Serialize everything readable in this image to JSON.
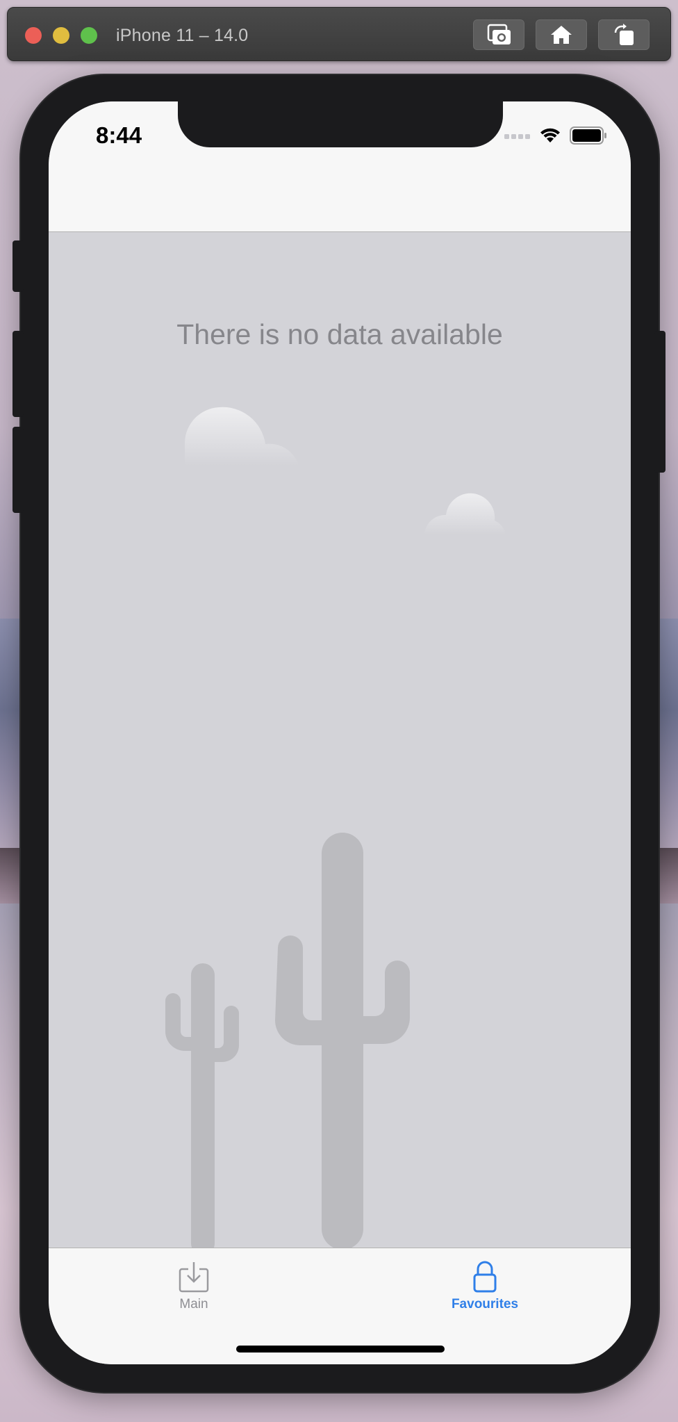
{
  "simulator": {
    "title": "iPhone 11 – 14.0",
    "buttons": [
      "camera-icon",
      "home-icon",
      "rotate-icon"
    ]
  },
  "status_bar": {
    "time": "8:44",
    "icons": [
      "cellular-signal-icon",
      "wifi-icon",
      "battery-icon"
    ]
  },
  "content": {
    "empty_message": "There is no data available",
    "illustration": [
      "cloud-icon",
      "cloud-icon",
      "cactus-icon",
      "cactus-icon"
    ]
  },
  "tab_bar": {
    "tabs": [
      {
        "label": "Main",
        "icon": "download-tray-icon",
        "selected": false
      },
      {
        "label": "Favourites",
        "icon": "lock-icon",
        "selected": true
      }
    ]
  },
  "colors": {
    "accent": "#2f7fe8",
    "inactive": "#8e8e93",
    "content_bg": "#d3d3d8",
    "bar_bg": "#f7f7f7"
  }
}
